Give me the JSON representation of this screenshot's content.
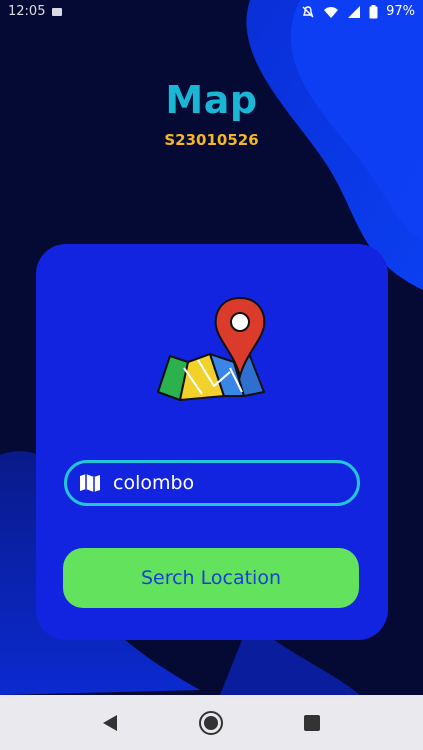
{
  "status_bar": {
    "time": "12:05",
    "battery_percent": "97%",
    "icons": [
      "mute-icon",
      "wifi-icon",
      "signal-icon",
      "battery-icon"
    ]
  },
  "app": {
    "title": "Map",
    "student_id": "S23010526"
  },
  "search": {
    "icon": "map-icon",
    "value": "colombo"
  },
  "buttons": {
    "search_label": "Serch Location"
  },
  "nav": {
    "back": "back-icon",
    "home": "home-icon",
    "recents": "recents-icon"
  },
  "colors": {
    "background": "#050a35",
    "card": "#1324e0",
    "title": "#19b6d6",
    "student_id": "#f5b621",
    "button": "#63e25e",
    "button_text": "#1a3fd6",
    "input_border": "#22c6d8"
  }
}
